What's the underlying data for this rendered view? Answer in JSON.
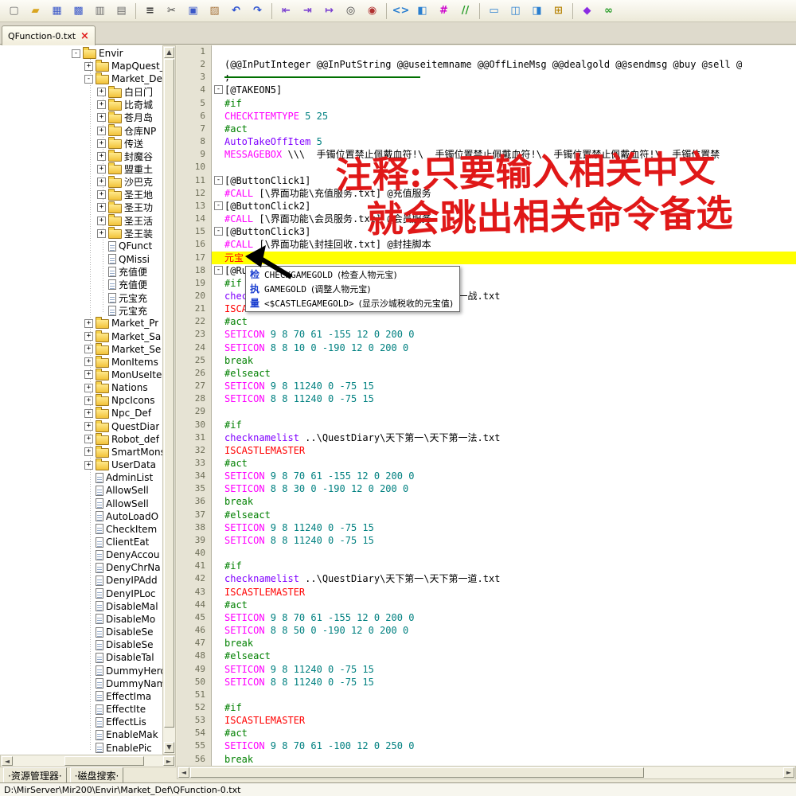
{
  "window": {
    "status_path": "D:\\MirServer\\Mir200\\Envir\\Market_Def\\QFunction-0.txt"
  },
  "tabs": {
    "active": "QFunction-0.txt",
    "close_glyph": "×"
  },
  "panel_tabs": {
    "resource": "·资源管理器·",
    "disk": "·磁盘搜索·"
  },
  "toolbar": {
    "icons": [
      {
        "name": "new-file-icon",
        "glyph": "▢",
        "color": "#6b6b6b"
      },
      {
        "name": "open-folder-icon",
        "glyph": "▰",
        "color": "#d9a520"
      },
      {
        "name": "save-icon",
        "glyph": "▦",
        "color": "#3a57c8"
      },
      {
        "name": "save-all-icon",
        "glyph": "▩",
        "color": "#3a57c8"
      },
      {
        "name": "export-page-icon",
        "glyph": "▥",
        "color": "#6b6b6b"
      },
      {
        "name": "properties-icon",
        "glyph": "▤",
        "color": "#6b6b6b"
      },
      {
        "sep": true
      },
      {
        "name": "list-icon",
        "glyph": "≡",
        "color": "#333333"
      },
      {
        "name": "cut-icon",
        "glyph": "✂",
        "color": "#444444"
      },
      {
        "name": "copy-icon",
        "glyph": "▣",
        "color": "#3a57c8"
      },
      {
        "name": "paste-icon",
        "glyph": "▨",
        "color": "#a6733c"
      },
      {
        "name": "undo-icon",
        "glyph": "↶",
        "color": "#2a4fd0"
      },
      {
        "name": "redo-icon",
        "glyph": "↷",
        "color": "#2a4fd0"
      },
      {
        "sep": true
      },
      {
        "name": "indent-left-icon",
        "glyph": "⇤",
        "color": "#7a3fd0"
      },
      {
        "name": "indent-right-icon",
        "glyph": "⇥",
        "color": "#7a3fd0"
      },
      {
        "name": "insert-line-icon",
        "glyph": "↦",
        "color": "#7a3fd0"
      },
      {
        "name": "find-page-icon",
        "glyph": "◎",
        "color": "#444444"
      },
      {
        "name": "replace-icon",
        "glyph": "◉",
        "color": "#b03030"
      },
      {
        "sep": true
      },
      {
        "name": "code-tags-icon",
        "glyph": "<>",
        "color": "#2a7fd0"
      },
      {
        "name": "split-page-icon",
        "glyph": "◧",
        "color": "#2a7fd0"
      },
      {
        "name": "hash-icon",
        "glyph": "#",
        "color": "#cc00cc"
      },
      {
        "name": "comment-icon",
        "glyph": "//",
        "color": "#2a9d2a"
      },
      {
        "sep": true
      },
      {
        "name": "window-icon",
        "glyph": "▭",
        "color": "#2a7fd0"
      },
      {
        "name": "split-horizontal-icon",
        "glyph": "◫",
        "color": "#2a7fd0"
      },
      {
        "name": "split-vertical-icon",
        "glyph": "◨",
        "color": "#2a7fd0"
      },
      {
        "name": "calculator-icon",
        "glyph": "⊞",
        "color": "#b8860b"
      },
      {
        "sep": true
      },
      {
        "name": "clean-icon",
        "glyph": "◆",
        "color": "#8a2be2"
      },
      {
        "name": "link-icon",
        "glyph": "∞",
        "color": "#2a9d2a"
      }
    ]
  },
  "tree": {
    "items": [
      {
        "t": "Envir",
        "ty": "f",
        "e": "-",
        "l": 0
      },
      {
        "t": "MapQuest_",
        "ty": "f",
        "e": "+",
        "l": 1
      },
      {
        "t": "Market_De",
        "ty": "f",
        "e": "-",
        "l": 1
      },
      {
        "t": "白日门",
        "ty": "f",
        "e": "+",
        "l": 2
      },
      {
        "t": "比奇城",
        "ty": "f",
        "e": "+",
        "l": 2
      },
      {
        "t": "苍月岛",
        "ty": "f",
        "e": "+",
        "l": 2
      },
      {
        "t": "仓库NP",
        "ty": "f",
        "e": "+",
        "l": 2
      },
      {
        "t": "传送",
        "ty": "f",
        "e": "+",
        "l": 2
      },
      {
        "t": "封魔谷",
        "ty": "f",
        "e": "+",
        "l": 2
      },
      {
        "t": "盟重土",
        "ty": "f",
        "e": "+",
        "l": 2
      },
      {
        "t": "沙巴克",
        "ty": "f",
        "e": "+",
        "l": 2
      },
      {
        "t": "圣王地",
        "ty": "f",
        "e": "+",
        "l": 2
      },
      {
        "t": "圣王功",
        "ty": "f",
        "e": "+",
        "l": 2
      },
      {
        "t": "圣王活",
        "ty": "f",
        "e": "+",
        "l": 2
      },
      {
        "t": "圣王装",
        "ty": "f",
        "e": "+",
        "l": 2
      },
      {
        "t": "QFunct",
        "ty": "d",
        "l": 2
      },
      {
        "t": "QMissi",
        "ty": "d",
        "l": 2
      },
      {
        "t": "充值便",
        "ty": "d",
        "l": 2
      },
      {
        "t": "充值便",
        "ty": "d",
        "l": 2
      },
      {
        "t": "元宝充",
        "ty": "d",
        "l": 2
      },
      {
        "t": "元宝充",
        "ty": "d",
        "l": 2
      },
      {
        "t": "Market_Pr",
        "ty": "f",
        "e": "+",
        "l": 1
      },
      {
        "t": "Market_Sa",
        "ty": "f",
        "e": "+",
        "l": 1
      },
      {
        "t": "Market_Se",
        "ty": "f",
        "e": "+",
        "l": 1
      },
      {
        "t": "MonItems",
        "ty": "f",
        "e": "+",
        "l": 1
      },
      {
        "t": "MonUseIte",
        "ty": "f",
        "e": "+",
        "l": 1
      },
      {
        "t": "Nations",
        "ty": "f",
        "e": "+",
        "l": 1
      },
      {
        "t": "NpcIcons",
        "ty": "f",
        "e": "+",
        "l": 1
      },
      {
        "t": "Npc_Def",
        "ty": "f",
        "e": "+",
        "l": 1
      },
      {
        "t": "QuestDiar",
        "ty": "f",
        "e": "+",
        "l": 1
      },
      {
        "t": "Robot_def",
        "ty": "f",
        "e": "+",
        "l": 1
      },
      {
        "t": "SmartMons",
        "ty": "f",
        "e": "+",
        "l": 1
      },
      {
        "t": "UserData",
        "ty": "f",
        "e": "+",
        "l": 1
      },
      {
        "t": "AdminList",
        "ty": "d",
        "l": 1
      },
      {
        "t": "AllowSell",
        "ty": "d",
        "l": 1
      },
      {
        "t": "AllowSell",
        "ty": "d",
        "l": 1
      },
      {
        "t": "AutoLoadO",
        "ty": "d",
        "l": 1
      },
      {
        "t": "CheckItem",
        "ty": "d",
        "l": 1
      },
      {
        "t": "ClientEat",
        "ty": "d",
        "l": 1
      },
      {
        "t": "DenyAccou",
        "ty": "d",
        "l": 1
      },
      {
        "t": "DenyChrNa",
        "ty": "d",
        "l": 1
      },
      {
        "t": "DenyIPAdd",
        "ty": "d",
        "l": 1
      },
      {
        "t": "DenyIPLoc",
        "ty": "d",
        "l": 1
      },
      {
        "t": "DisableMal",
        "ty": "d",
        "l": 1
      },
      {
        "t": "DisableMo",
        "ty": "d",
        "l": 1
      },
      {
        "t": "DisableSe",
        "ty": "d",
        "l": 1
      },
      {
        "t": "DisableSe",
        "ty": "d",
        "l": 1
      },
      {
        "t": "DisableTal",
        "ty": "d",
        "l": 1
      },
      {
        "t": "DummyHero",
        "ty": "d",
        "l": 1
      },
      {
        "t": "DummyName",
        "ty": "d",
        "l": 1
      },
      {
        "t": "EffectIma",
        "ty": "d",
        "l": 1
      },
      {
        "t": "EffectIte",
        "ty": "d",
        "l": 1
      },
      {
        "t": "EffectLis",
        "ty": "d",
        "l": 1
      },
      {
        "t": "EnableMak",
        "ty": "d",
        "l": 1
      },
      {
        "t": "EnablePic",
        "ty": "d",
        "l": 1
      }
    ]
  },
  "editor": {
    "lines": [
      {
        "n": 1,
        "s": []
      },
      {
        "n": 2,
        "s": [
          [
            "k",
            "(@@InPutInteger @@InPutString @@useitemname @@OffLineMsg @@dealgold @@sendmsg @buy @sell @"
          ]
        ]
      },
      {
        "n": 3,
        "s": [
          [
            "k",
            ";"
          ]
        ]
      },
      {
        "n": 4,
        "f": 1,
        "s": [
          [
            "k",
            "[@TAKEON5]"
          ]
        ]
      },
      {
        "n": 5,
        "s": [
          [
            "g",
            "#if"
          ]
        ]
      },
      {
        "n": 6,
        "s": [
          [
            "m",
            "CHECKITEMTYPE"
          ],
          [
            "t",
            " 5 25"
          ]
        ]
      },
      {
        "n": 7,
        "s": [
          [
            "g",
            "#act"
          ]
        ]
      },
      {
        "n": 8,
        "s": [
          [
            "v",
            "AutoTakeOffItem"
          ],
          [
            "t",
            " 5"
          ]
        ]
      },
      {
        "n": 9,
        "s": [
          [
            "m",
            "MESSAGEBOX"
          ],
          [
            "k",
            " \\\\\\  手镯位置禁止佩戴血符!\\  手镯位置禁止佩戴血符!\\  手镯位置禁止佩戴血符!\\  手镯位置禁"
          ]
        ]
      },
      {
        "n": 10,
        "s": []
      },
      {
        "n": 11,
        "f": 1,
        "s": [
          [
            "k",
            "[@ButtonClick1]"
          ]
        ]
      },
      {
        "n": 12,
        "s": [
          [
            "m",
            "#CALL"
          ],
          [
            "k",
            " [\\界面功能\\充值服务.txt] @充值服务"
          ]
        ]
      },
      {
        "n": 13,
        "f": 1,
        "s": [
          [
            "k",
            "[@ButtonClick2]"
          ]
        ]
      },
      {
        "n": 14,
        "s": [
          [
            "m",
            "#CALL"
          ],
          [
            "k",
            " [\\界面功能\\会员服务.txt] @会员服务"
          ]
        ]
      },
      {
        "n": 15,
        "f": 1,
        "s": [
          [
            "k",
            "[@ButtonClick3]"
          ]
        ]
      },
      {
        "n": 16,
        "s": [
          [
            "m",
            "#CALL"
          ],
          [
            "k",
            " [\\界面功能\\封挂回收.txt] @封挂脚本"
          ]
        ]
      },
      {
        "n": 17,
        "h": 1,
        "s": [
          [
            "r",
            "元宝"
          ]
        ]
      },
      {
        "n": 18,
        "f": 1,
        "s": [
          [
            "k",
            "[@Ru"
          ]
        ]
      },
      {
        "n": 19,
        "s": [
          [
            "g",
            "#if"
          ]
        ]
      },
      {
        "n": 20,
        "s": [
          [
            "v",
            "checknamelist"
          ],
          [
            "k",
            " ..\\QuestDiary\\天下第一\\天下第一战.txt"
          ]
        ]
      },
      {
        "n": 21,
        "s": [
          [
            "r",
            "ISCASTLEMASTER"
          ]
        ]
      },
      {
        "n": 22,
        "s": [
          [
            "g",
            "#act"
          ]
        ]
      },
      {
        "n": 23,
        "s": [
          [
            "m",
            "SETICON"
          ],
          [
            "t",
            " 9 8 70 61 -155 12 0 200 0"
          ]
        ]
      },
      {
        "n": 24,
        "s": [
          [
            "m",
            "SETICON"
          ],
          [
            "t",
            " 8 8 10 0 -190 12 0 200 0"
          ]
        ]
      },
      {
        "n": 25,
        "s": [
          [
            "g",
            "break"
          ]
        ]
      },
      {
        "n": 26,
        "s": [
          [
            "g",
            "#elseact"
          ]
        ]
      },
      {
        "n": 27,
        "s": [
          [
            "m",
            "SETICON"
          ],
          [
            "t",
            " 9 8 11240 0 -75 15"
          ]
        ]
      },
      {
        "n": 28,
        "s": [
          [
            "m",
            "SETICON"
          ],
          [
            "t",
            " 8 8 11240 0 -75 15"
          ]
        ]
      },
      {
        "n": 29,
        "s": []
      },
      {
        "n": 30,
        "s": [
          [
            "g",
            "#if"
          ]
        ]
      },
      {
        "n": 31,
        "s": [
          [
            "v",
            "checknamelist"
          ],
          [
            "k",
            " ..\\QuestDiary\\天下第一\\天下第一法.txt"
          ]
        ]
      },
      {
        "n": 32,
        "s": [
          [
            "r",
            "ISCASTLEMASTER"
          ]
        ]
      },
      {
        "n": 33,
        "s": [
          [
            "g",
            "#act"
          ]
        ]
      },
      {
        "n": 34,
        "s": [
          [
            "m",
            "SETICON"
          ],
          [
            "t",
            " 9 8 70 61 -155 12 0 200 0"
          ]
        ]
      },
      {
        "n": 35,
        "s": [
          [
            "m",
            "SETICON"
          ],
          [
            "t",
            " 8 8 30 0 -190 12 0 200 0"
          ]
        ]
      },
      {
        "n": 36,
        "s": [
          [
            "g",
            "break"
          ]
        ]
      },
      {
        "n": 37,
        "s": [
          [
            "g",
            "#elseact"
          ]
        ]
      },
      {
        "n": 38,
        "s": [
          [
            "m",
            "SETICON"
          ],
          [
            "t",
            " 9 8 11240 0 -75 15"
          ]
        ]
      },
      {
        "n": 39,
        "s": [
          [
            "m",
            "SETICON"
          ],
          [
            "t",
            " 8 8 11240 0 -75 15"
          ]
        ]
      },
      {
        "n": 40,
        "s": []
      },
      {
        "n": 41,
        "s": [
          [
            "g",
            "#if"
          ]
        ]
      },
      {
        "n": 42,
        "s": [
          [
            "v",
            "checknamelist"
          ],
          [
            "k",
            " ..\\QuestDiary\\天下第一\\天下第一道.txt"
          ]
        ]
      },
      {
        "n": 43,
        "s": [
          [
            "r",
            "ISCASTLEMASTER"
          ]
        ]
      },
      {
        "n": 44,
        "s": [
          [
            "g",
            "#act"
          ]
        ]
      },
      {
        "n": 45,
        "s": [
          [
            "m",
            "SETICON"
          ],
          [
            "t",
            " 9 8 70 61 -155 12 0 200 0"
          ]
        ]
      },
      {
        "n": 46,
        "s": [
          [
            "m",
            "SETICON"
          ],
          [
            "t",
            " 8 8 50 0 -190 12 0 200 0"
          ]
        ]
      },
      {
        "n": 47,
        "s": [
          [
            "g",
            "break"
          ]
        ]
      },
      {
        "n": 48,
        "s": [
          [
            "g",
            "#elseact"
          ]
        ]
      },
      {
        "n": 49,
        "s": [
          [
            "m",
            "SETICON"
          ],
          [
            "t",
            " 9 8 11240 0 -75 15"
          ]
        ]
      },
      {
        "n": 50,
        "s": [
          [
            "m",
            "SETICON"
          ],
          [
            "t",
            " 8 8 11240 0 -75 15"
          ]
        ]
      },
      {
        "n": 51,
        "s": []
      },
      {
        "n": 52,
        "s": [
          [
            "g",
            "#if"
          ]
        ]
      },
      {
        "n": 53,
        "s": [
          [
            "r",
            "ISCASTLEMASTER"
          ]
        ]
      },
      {
        "n": 54,
        "s": [
          [
            "g",
            "#act"
          ]
        ]
      },
      {
        "n": 55,
        "s": [
          [
            "m",
            "SETICON"
          ],
          [
            "t",
            " 9 8 70 61 -100 12 0 250 0"
          ]
        ]
      },
      {
        "n": 56,
        "s": [
          [
            "g",
            "break"
          ]
        ]
      }
    ]
  },
  "popup": {
    "items": [
      {
        "icon": "检",
        "cmd": "CHECKGAMEGOLD",
        "desc": "(检查人物元宝)"
      },
      {
        "icon": "执",
        "cmd": "GAMEGOLD",
        "desc": "(调整人物元宝)"
      },
      {
        "icon": "量",
        "cmd": "<$CASTLEGAMEGOLD>",
        "desc": "(显示沙城税收的元宝值)"
      }
    ]
  },
  "annotation": {
    "lines": [
      "注释:只要输入相关中文",
      "就会跳出相关命令备选"
    ],
    "color": "#e01818"
  }
}
